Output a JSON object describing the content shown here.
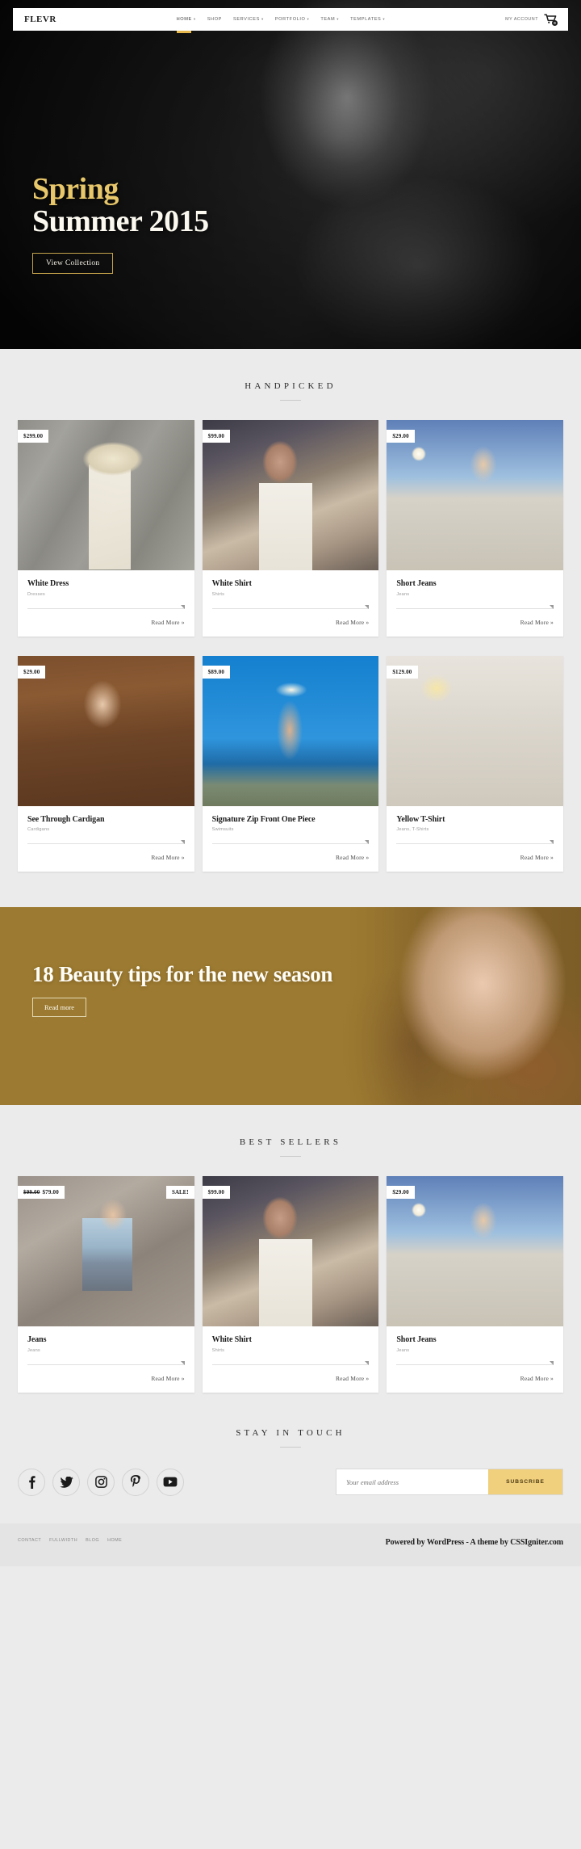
{
  "header": {
    "brand": "FLEVR",
    "nav": [
      {
        "label": "HOME",
        "caret": "▾",
        "active": true
      },
      {
        "label": "SHOP",
        "caret": "",
        "active": false
      },
      {
        "label": "SERVICES",
        "caret": "▾",
        "active": false
      },
      {
        "label": "PORTFOLIO",
        "caret": "▾",
        "active": false
      },
      {
        "label": "TEAM",
        "caret": "▾",
        "active": false
      },
      {
        "label": "TEMPLATES",
        "caret": "▾",
        "active": false
      }
    ],
    "my_account": "MY ACCOUNT",
    "cart_count": "0"
  },
  "hero": {
    "line1": "Spring",
    "line2": "Summer 2015",
    "button": "View Collection",
    "accent_color": "#e8c76a"
  },
  "handpicked": {
    "title": "HANDPICKED",
    "products": [
      {
        "price": "$299.00",
        "name": "White Dress",
        "category": "Dresses",
        "read_more": "Read More »"
      },
      {
        "price": "$99.00",
        "name": "White Shirt",
        "category": "Shirts",
        "read_more": "Read More »"
      },
      {
        "price": "$29.00",
        "name": "Short Jeans",
        "category": "Jeans",
        "read_more": "Read More »"
      },
      {
        "price": "$29.00",
        "name": "See Through Cardigan",
        "category": "Cardigans",
        "read_more": "Read More »"
      },
      {
        "price": "$89.00",
        "name": "Signature Zip Front One Piece",
        "category": "Swimsuits",
        "read_more": "Read More »"
      },
      {
        "price": "$129.00",
        "name": "Yellow T-Shirt",
        "category": "Jeans, T-Shirts",
        "read_more": "Read More »"
      }
    ]
  },
  "banner": {
    "title": "18 Beauty tips for the new season",
    "button": "Read more",
    "background_color": "#9c7a31"
  },
  "best_sellers": {
    "title": "BEST SELLERS",
    "products": [
      {
        "old_price": "$99.00",
        "price": "$79.00",
        "badge": "SALE!",
        "name": "Jeans",
        "category": "Jeans",
        "read_more": "Read More »"
      },
      {
        "old_price": "",
        "price": "$99.00",
        "badge": "",
        "name": "White Shirt",
        "category": "Shirts",
        "read_more": "Read More »"
      },
      {
        "old_price": "",
        "price": "$29.00",
        "badge": "",
        "name": "Short Jeans",
        "category": "Jeans",
        "read_more": "Read More »"
      }
    ]
  },
  "newsletter": {
    "title": "STAY IN TOUCH",
    "socials": [
      "facebook-icon",
      "twitter-icon",
      "instagram-icon",
      "pinterest-icon",
      "youtube-icon"
    ],
    "email_placeholder": "Your email address",
    "email_value": "",
    "subscribe_label": "SUBSCRIBE",
    "subscribe_color": "#f0cf7d"
  },
  "footer": {
    "links": [
      "CONTACT",
      "FULLWIDTH",
      "BLOG",
      "HOME"
    ],
    "credit": "Powered by WordPress - A theme by CSSIgniter.com"
  }
}
